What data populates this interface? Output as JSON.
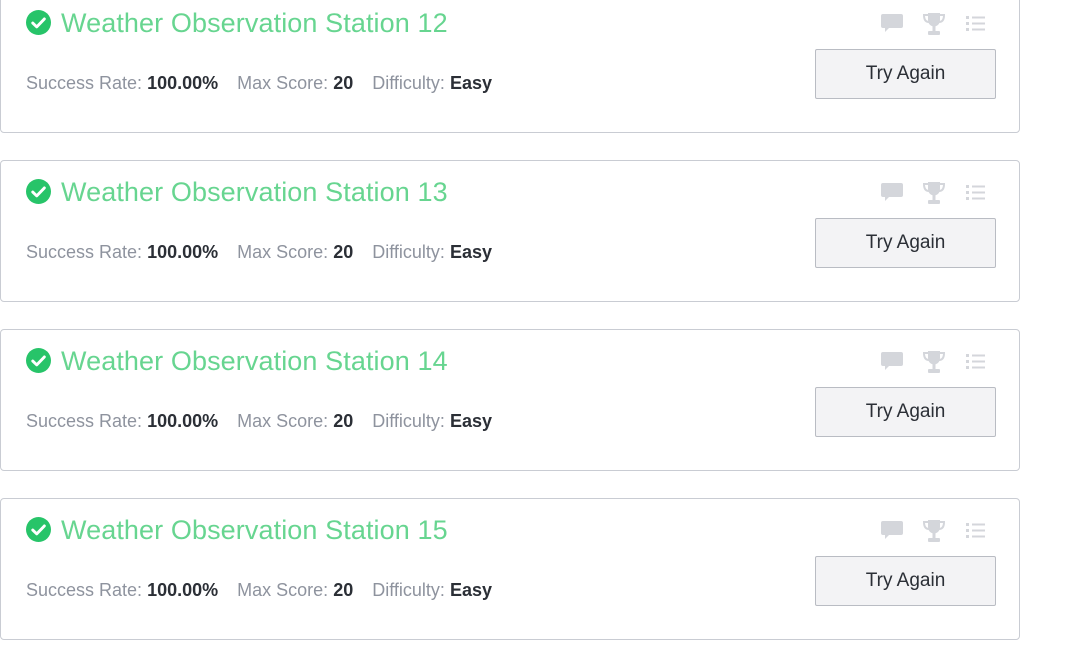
{
  "colors": {
    "title_green": "#67d590",
    "check_green": "#27c469",
    "label_gray": "#8e939e",
    "value_dark": "#2b2f36",
    "icon_gray": "#d4d6db"
  },
  "icons": [
    "check-circle-icon",
    "comment-icon",
    "trophy-icon",
    "list-icon"
  ],
  "challenges": [
    {
      "title": "Weather Observation Station 12",
      "success_label": "Success Rate:",
      "success_value": "100.00%",
      "score_label": "Max Score:",
      "score_value": "20",
      "difficulty_label": "Difficulty:",
      "difficulty_value": "Easy",
      "button_label": "Try Again"
    },
    {
      "title": "Weather Observation Station 13",
      "success_label": "Success Rate:",
      "success_value": "100.00%",
      "score_label": "Max Score:",
      "score_value": "20",
      "difficulty_label": "Difficulty:",
      "difficulty_value": "Easy",
      "button_label": "Try Again"
    },
    {
      "title": "Weather Observation Station 14",
      "success_label": "Success Rate:",
      "success_value": "100.00%",
      "score_label": "Max Score:",
      "score_value": "20",
      "difficulty_label": "Difficulty:",
      "difficulty_value": "Easy",
      "button_label": "Try Again"
    },
    {
      "title": "Weather Observation Station 15",
      "success_label": "Success Rate:",
      "success_value": "100.00%",
      "score_label": "Max Score:",
      "score_value": "20",
      "difficulty_label": "Difficulty:",
      "difficulty_value": "Easy",
      "button_label": "Try Again"
    }
  ]
}
